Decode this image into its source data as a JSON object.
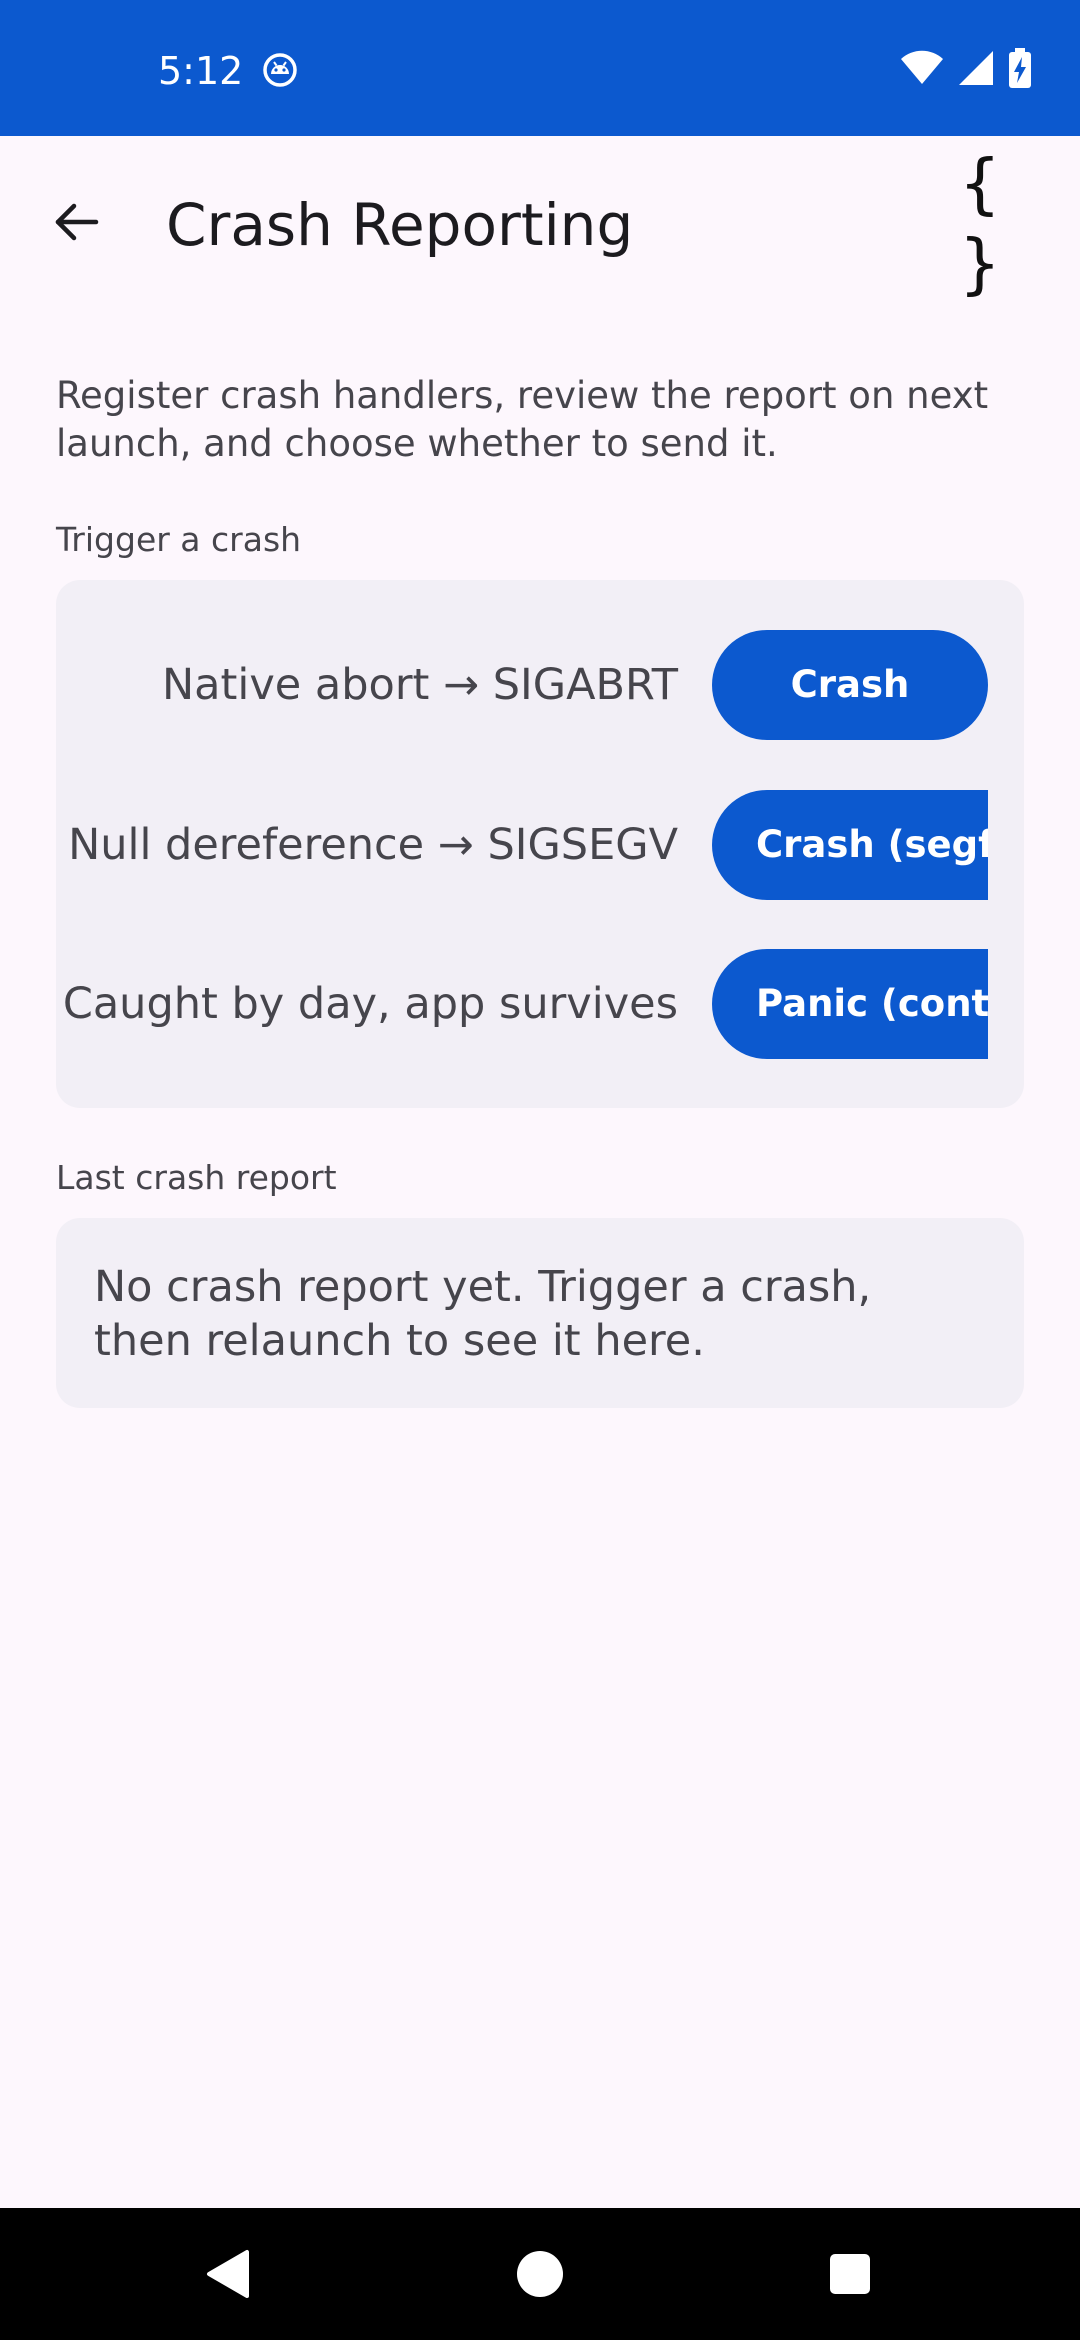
{
  "status_bar": {
    "time": "5:12",
    "app_icon": "android-robot-icon",
    "icons": [
      "wifi-icon",
      "signal-icon",
      "battery-charging-icon"
    ],
    "background_color": "#0c59cf"
  },
  "app_bar": {
    "back_icon": "arrow-back-icon",
    "title": "Crash Reporting",
    "action_label": "{ }",
    "action_icon": "curly-braces-icon"
  },
  "description": "Register crash handlers, review the report on next launch, and choose whether to send it.",
  "trigger_section": {
    "label": "Trigger a crash",
    "rows": [
      {
        "label": "Native abort → SIGABRT",
        "button": "Crash"
      },
      {
        "label": "Null dereference → SIGSEGV",
        "button": "Crash (segfault)"
      },
      {
        "label": "Caught by day, app survives",
        "button": "Panic (contained)"
      }
    ]
  },
  "report_section": {
    "label": "Last crash report",
    "text": "No crash report yet. Trigger a crash, then relaunch to see it here."
  },
  "nav_bar": {
    "icons": [
      "nav-back-icon",
      "nav-home-icon",
      "nav-recents-icon"
    ]
  },
  "colors": {
    "accent": "#0c59cf",
    "background": "#fdf7fd",
    "card": "#f2eff6",
    "text_primary": "#1c1b1f",
    "text_secondary": "#46454c"
  }
}
